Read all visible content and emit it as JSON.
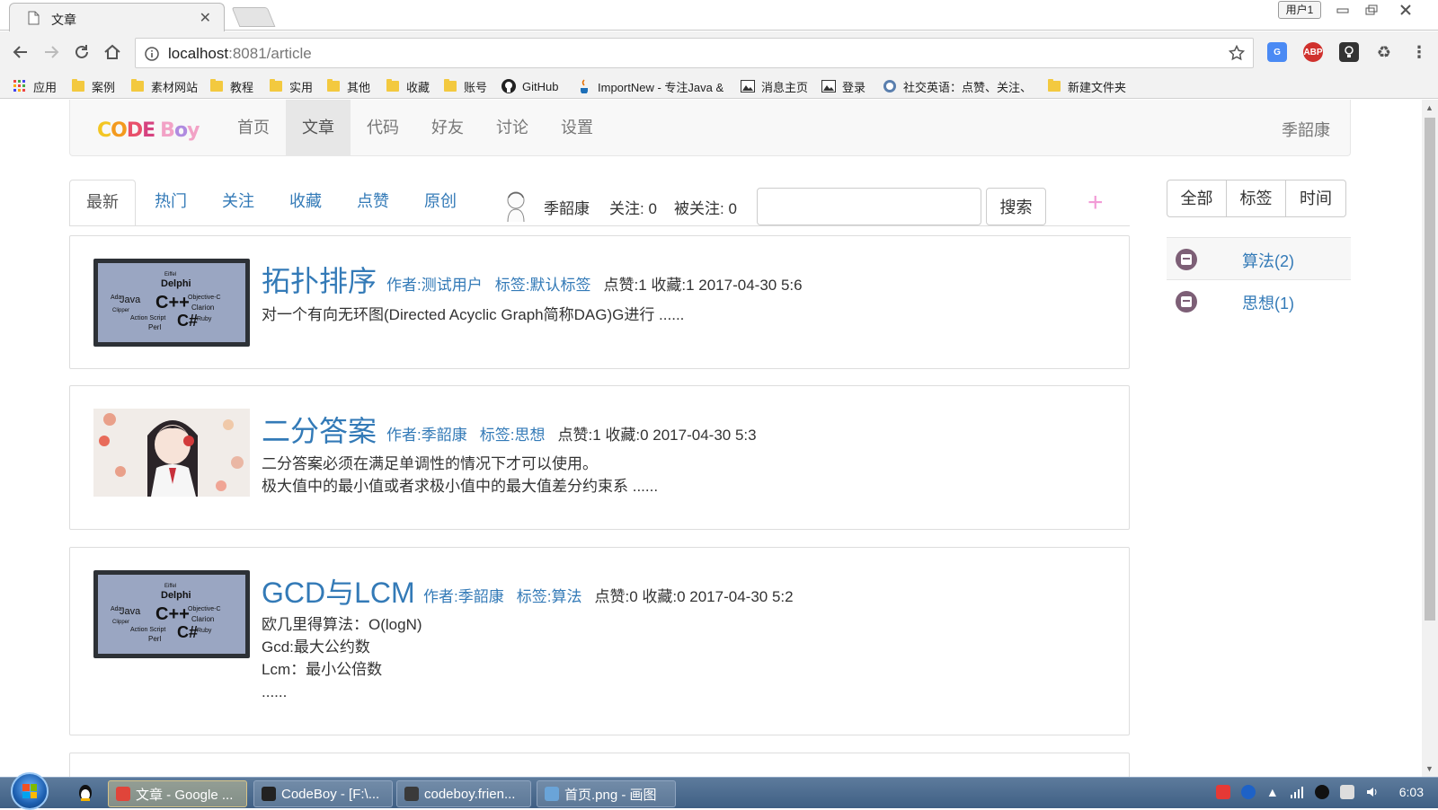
{
  "browser": {
    "tab_title": "文章",
    "tab_close": "✕",
    "user_button": "用户1",
    "url_host": "localhost",
    "url_rest": ":8081/article",
    "extensions": {
      "abp": "ABP"
    }
  },
  "bookmarks": [
    {
      "label": "应用",
      "icon": "apps-icon"
    },
    {
      "label": "案例",
      "icon": "folder-icon"
    },
    {
      "label": "素材网站",
      "icon": "folder-icon"
    },
    {
      "label": "教程",
      "icon": "folder-icon"
    },
    {
      "label": "实用",
      "icon": "folder-icon"
    },
    {
      "label": "其他",
      "icon": "folder-icon"
    },
    {
      "label": "收藏",
      "icon": "folder-icon"
    },
    {
      "label": "账号",
      "icon": "folder-icon"
    },
    {
      "label": "GitHub",
      "icon": "github-icon"
    },
    {
      "label": "ImportNew - 专注Java &",
      "icon": "java-icon"
    },
    {
      "label": "消息主页",
      "icon": "image-icon"
    },
    {
      "label": "登录",
      "icon": "image-icon"
    },
    {
      "label": "社交英语：点赞、关注、",
      "icon": "globe-icon"
    },
    {
      "label": "新建文件夹",
      "icon": "folder-icon"
    }
  ],
  "site": {
    "logo": "CODE Boy",
    "nav": [
      "首页",
      "文章",
      "代码",
      "好友",
      "讨论",
      "设置"
    ],
    "active_nav": "文章",
    "user": "季韶康"
  },
  "subtabs": [
    "最新",
    "热门",
    "关注",
    "收藏",
    "点赞",
    "原创"
  ],
  "profile": {
    "name": "季韶康",
    "following": "关注: 0",
    "followers": "被关注: 0"
  },
  "search": {
    "placeholder": "",
    "button": "搜索",
    "add": "+"
  },
  "articles": [
    {
      "title": "拓扑排序",
      "author": "作者:测试用户",
      "tag": "标签:默认标签",
      "stats": "点赞:1 收藏:1 2017-04-30 5:6",
      "summary": [
        "对一个有向无环图(Directed Acyclic Graph简称DAG)G进行 ......"
      ],
      "thumb_words": [
        "Delphi",
        "Java",
        "C++",
        "C#",
        "Objective-C",
        "Clarion",
        "Ruby",
        "Ada",
        "Clipper",
        "Action Script",
        "Perl",
        "Eiffel"
      ]
    },
    {
      "title": "二分答案",
      "author": "作者:季韶康",
      "tag": "标签:思想",
      "stats": "点赞:1 收藏:0 2017-04-30 5:3",
      "summary": [
        "二分答案必须在满足单调性的情况下才可以使用。",
        "极大值中的最小值或者求极小值中的最大值差分约束系 ......"
      ]
    },
    {
      "title": "GCD与LCM",
      "author": "作者:季韶康",
      "tag": "标签:算法",
      "stats": "点赞:0 收藏:0 2017-04-30 5:2",
      "summary": [
        "欧几里得算法：O(logN)",
        "Gcd:最大公约数",
        "Lcm：最小公倍数",
        "......"
      ],
      "thumb_words": [
        "Delphi",
        "Java",
        "C++",
        "C#",
        "Objective-C",
        "Clarion",
        "Ruby",
        "Ada",
        "Clipper",
        "Action Script",
        "Perl",
        "Eiffel"
      ]
    }
  ],
  "filters": [
    "全部",
    "标签",
    "时间"
  ],
  "tags": [
    {
      "label": "算法(2)"
    },
    {
      "label": "思想(1)"
    }
  ],
  "taskbar": {
    "items": [
      {
        "label": "文章 - Google ...",
        "color": "#e0453a"
      },
      {
        "label": "CodeBoy - [F:\\...",
        "color": "#222222"
      },
      {
        "label": "codeboy.frien...",
        "color": "#3a3a3a"
      },
      {
        "label": "首页.png - 画图",
        "color": "#6aa4d8"
      }
    ],
    "clock": "6:03"
  },
  "colors": {
    "link": "#337ab7",
    "plus": "#f29bd6",
    "tag_icon": "#7d5f76"
  }
}
